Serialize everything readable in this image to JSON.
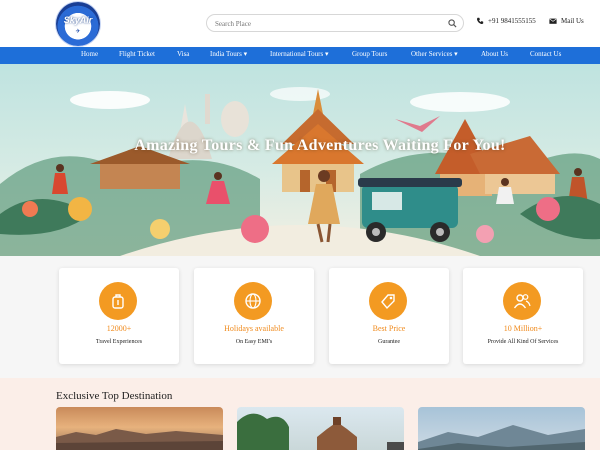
{
  "header": {
    "logo_text": "SkyAir",
    "logo_sub": "✈",
    "search_placeholder": "Search Place",
    "phone": "+91 9841555155",
    "mail": "Mail Us"
  },
  "nav": {
    "items": [
      {
        "label": "Home"
      },
      {
        "label": "Flight Ticket"
      },
      {
        "label": "Visa"
      },
      {
        "label": "India Tours ▾"
      },
      {
        "label": "International Tours ▾"
      },
      {
        "label": "Group Tours"
      },
      {
        "label": "Other Services ▾"
      },
      {
        "label": "About Us"
      },
      {
        "label": "Contact Us"
      }
    ],
    "color": "#1e6fd9"
  },
  "hero": {
    "title": "Amazing Tours & Fun Adventures Waiting For You!"
  },
  "features": [
    {
      "icon": "luggage-icon",
      "title": "12000+",
      "subtitle": "Travel Experiences"
    },
    {
      "icon": "globe-icon",
      "title": "Holidays available",
      "subtitle": "On Easy EMI's"
    },
    {
      "icon": "price-tag-icon",
      "title": "Best Price",
      "subtitle": "Gurantee"
    },
    {
      "icon": "users-icon",
      "title": "10 Million+",
      "subtitle": "Provide All Kind Of Services"
    }
  ],
  "accent_color": "#f39a22",
  "destinations": {
    "heading": "Exclusive Top Destination"
  }
}
